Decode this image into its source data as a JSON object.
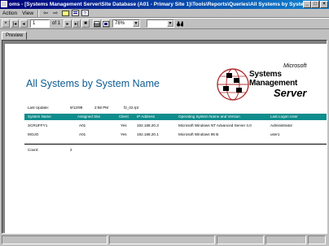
{
  "window": {
    "title": "oms - [Systems Management Server\\Site Database (A01 - Primary Site 1)\\Tools\\Reports\\Queries\\All Systems by System Name"
  },
  "menu": {
    "action": "Action",
    "view": "View"
  },
  "toolbar": {
    "page_value": "1",
    "page_of": "of 1",
    "zoom": "78%",
    "search_value": ""
  },
  "tabs": [
    "Preview"
  ],
  "report": {
    "title": "All Systems by System Name",
    "last_update_label": "Last Update:",
    "last_update_date": "9/12/99",
    "last_update_time": "2:58 PM",
    "filename": "f2_02.rpt",
    "logo": {
      "microsoft": "Microsoft",
      "line1": "Systems",
      "line2": "Management",
      "line3": "Server"
    },
    "columns": [
      "System Name",
      "Assigned Site",
      "Client",
      "IP Address",
      "Operating System Name and Version",
      "Last Logon User"
    ],
    "rows": [
      [
        "SCRUFFY1",
        "A01",
        "Yes",
        "192.168.20.3",
        "Microsoft Windows NT Advanced Server 4.0",
        "Administrator"
      ],
      [
        "MOJO",
        "A01",
        "Yes",
        "192.168.20.1",
        "Microsoft Windows 95  B",
        "user1"
      ]
    ],
    "count_label": "Count:",
    "count_value": "2"
  },
  "colors": {
    "title_bar": "#00007b",
    "report_title": "#0d5c91",
    "table_header": "#0f8c8c"
  }
}
